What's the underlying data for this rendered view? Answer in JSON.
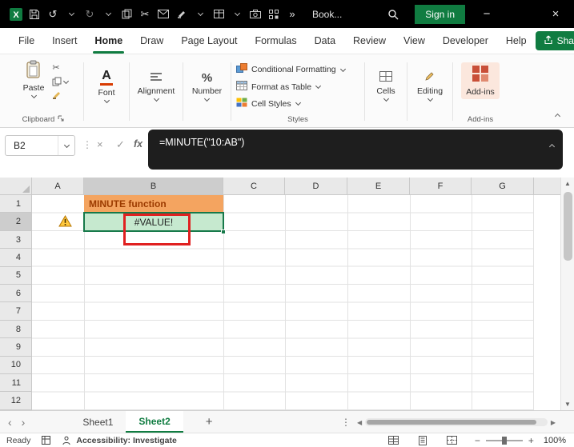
{
  "titlebar": {
    "workbook_name": "Book...",
    "sign_in_label": "Sign in"
  },
  "glyphs": {
    "excel_logo_letter": "X",
    "undo": "↺",
    "redo": "↻",
    "cut": "✂",
    "overflow": "»",
    "minimize": "−",
    "close": "×",
    "name_box_dots": "⋮",
    "cancel": "×",
    "enter": "✓",
    "fx": "fx",
    "font_icon_letter": "A",
    "percent_icon": "%",
    "sheet_prev": "‹",
    "sheet_next": "›",
    "add_sheet": "+",
    "sheet_menu_dots": "⋮",
    "scroll_up": "▲",
    "scroll_down": "▼",
    "scroll_left": "◀",
    "scroll_right": "▶",
    "zoom_out": "−",
    "zoom_in": "+"
  },
  "menu": {
    "tabs": [
      "File",
      "Insert",
      "Home",
      "Draw",
      "Page Layout",
      "Formulas",
      "Data",
      "Review",
      "View",
      "Developer",
      "Help"
    ],
    "active_tab": "Home",
    "share_label": "Share"
  },
  "ribbon": {
    "paste_label": "Paste",
    "clipboard_group_label": "Clipboard",
    "font_label": "Font",
    "alignment_label": "Alignment",
    "number_label": "Number",
    "conditional_formatting_label": "Conditional Formatting",
    "format_as_table_label": "Format as Table",
    "cell_styles_label": "Cell Styles",
    "styles_group_label": "Styles",
    "cells_label": "Cells",
    "editing_label": "Editing",
    "addins_label": "Add-ins",
    "addins_group_label": "Add-ins"
  },
  "formula_bar": {
    "name_box_value": "B2",
    "formula": "=MINUTE(\"10:AB\")"
  },
  "grid": {
    "columns": [
      "A",
      "B",
      "C",
      "D",
      "E",
      "F",
      "G"
    ],
    "rows": [
      "1",
      "2",
      "3",
      "4",
      "5",
      "6",
      "7",
      "8",
      "9",
      "10",
      "11",
      "12"
    ],
    "cells": {
      "B1": "MINUTE function",
      "B2": "#VALUE!"
    },
    "selected_cell": "B2"
  },
  "sheets": {
    "tab1": "Sheet1",
    "tab2": "Sheet2",
    "active": "Sheet2"
  },
  "status": {
    "mode": "Ready",
    "accessibility_label": "Accessibility: Investigate",
    "zoom_value": "100%"
  },
  "colors": {
    "accent_green": "#107C41",
    "title_bar_black": "#000000",
    "b1_fill": "#F4A460",
    "b1_text": "#9C3B00",
    "b2_fill": "#C6E9CF",
    "annotation_red": "#E02020",
    "addins_orange": "#C94F38",
    "formula_box_dark": "#1E1E1E"
  }
}
